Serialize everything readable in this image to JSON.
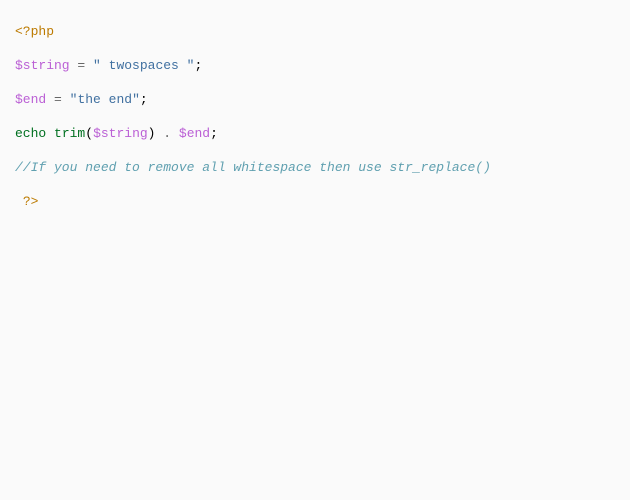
{
  "code": {
    "open_tag": "<?php",
    "line2": {
      "var": "$string",
      "eq": "=",
      "str": "\" twospaces \"",
      "semi": ";"
    },
    "line3": {
      "var": "$end",
      "eq": "=",
      "str": "\"the end\"",
      "semi": ";"
    },
    "line4": {
      "echo": "echo",
      "func": "trim",
      "lp": "(",
      "arg": "$string",
      "rp": ")",
      "concat": " . ",
      "var2": "$end",
      "semi": ";"
    },
    "line5": {
      "comment": "//If you need to remove all whitespace then use str_replace()"
    },
    "line6": {
      "sp": " ",
      "close": "?>"
    }
  }
}
